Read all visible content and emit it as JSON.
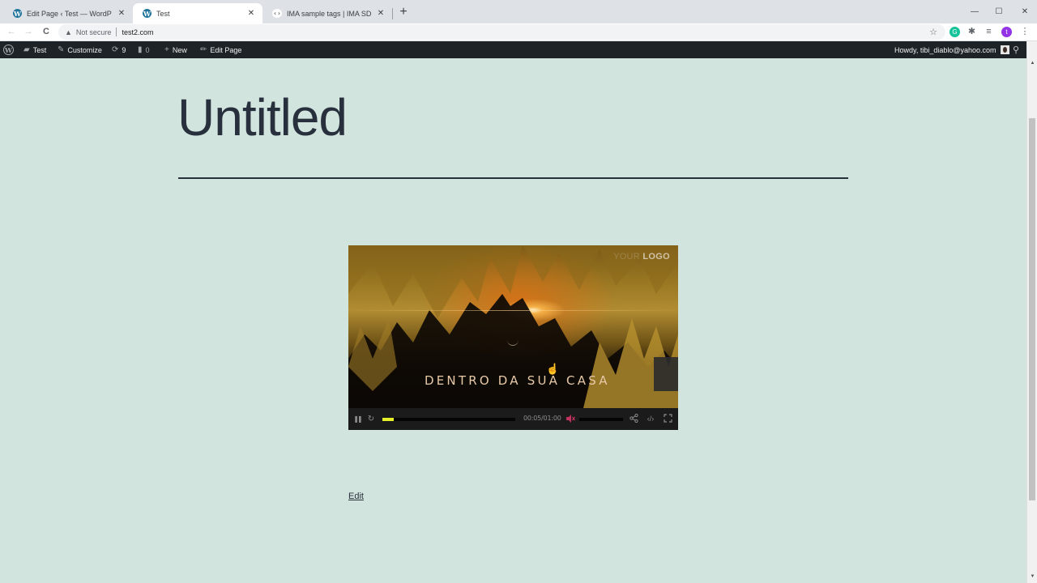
{
  "browser": {
    "tabs": [
      {
        "title": "Edit Page ‹ Test — WordPress",
        "icon": "wordpress-icon",
        "active": false
      },
      {
        "title": "Test",
        "icon": "wordpress-icon",
        "active": true
      },
      {
        "title": "IMA sample tags | IMA SDK for",
        "icon": "code-icon",
        "active": false
      }
    ],
    "new_tab_glyph": "+",
    "window_controls": {
      "minimize": "—",
      "maximize": "☐",
      "close": "✕"
    },
    "nav": {
      "back": "←",
      "forward": "→",
      "reload": "C"
    },
    "address": {
      "security_icon": "▲",
      "security_label": "Not secure",
      "url": "test2.com",
      "bookmark_glyph": "☆"
    },
    "extensions": [
      {
        "name": "grammarly-icon",
        "glyph": "G",
        "color": "#15c39a"
      },
      {
        "name": "extensions-puzzle-icon",
        "glyph": "✱",
        "color": "#5f6368"
      },
      {
        "name": "reading-list-icon",
        "glyph": "≡",
        "color": "#5f6368"
      },
      {
        "name": "profile-avatar-icon",
        "glyph": "t",
        "color": "#9334e6"
      }
    ],
    "menu_glyph": "⋮"
  },
  "adminbar": {
    "wp_logo": "W",
    "site_name": "Test",
    "customize": "Customize",
    "updates_count": "9",
    "comments_count": "0",
    "new_label": "New",
    "edit_page_label": "Edit Page",
    "howdy": "Howdy, tibi_diablo@yahoo.com",
    "search_glyph": "⚲"
  },
  "page": {
    "title": "Untitled",
    "edit_link": "Edit"
  },
  "player": {
    "logo_watermark_dim": "YOUR",
    "logo_watermark": "LOGO",
    "caption": "DENTRO DA SUA CASA",
    "state": "playing",
    "timecode": "00:05/01:00",
    "progress_fraction": 0.083,
    "volume_fraction": 0,
    "muted": true,
    "colors": {
      "progress": "#e6f02a",
      "mute": "#c2325e"
    },
    "icons": {
      "pause": "❚❚",
      "replay": "↻",
      "mute": "🔇",
      "share": "⋖",
      "embed": "‹/›",
      "fullscreen": "⛶"
    }
  }
}
